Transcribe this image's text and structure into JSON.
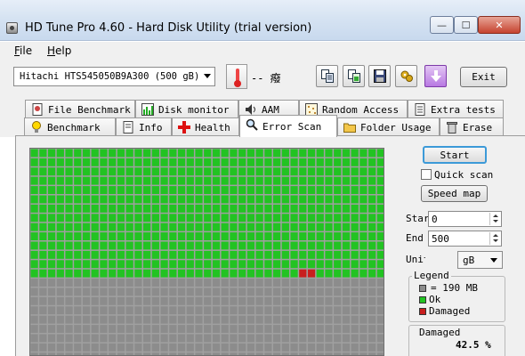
{
  "window": {
    "title": "HD Tune Pro 4.60 - Hard Disk Utility (trial version)",
    "controls": {
      "minimize": "—",
      "maximize": "☐",
      "close": "✕"
    }
  },
  "menu": {
    "items": [
      "File",
      "Help"
    ]
  },
  "toolbar": {
    "drive": "Hitachi HTS545050B9A300  (500 gB)",
    "temperature": "-- 癈",
    "buttons": [
      "copy-info-icon",
      "copy-screenshot-icon",
      "save-icon",
      "options-icon",
      "download-icon"
    ],
    "exit_label": "Exit"
  },
  "tabs": {
    "row1": [
      "File Benchmark",
      "Disk monitor",
      "AAM",
      "Random Access",
      "Extra tests"
    ],
    "row2": [
      "Benchmark",
      "Info",
      "Health",
      "Error Scan",
      "Folder Usage",
      "Erase"
    ],
    "active": "Error Scan"
  },
  "error_scan": {
    "start_label": "Start",
    "quick_scan_label": "Quick scan",
    "quick_scan_checked": false,
    "speed_map_label": "Speed map",
    "start_field_label": "Star",
    "start_value": "0",
    "end_field_label": "End",
    "end_value": "500",
    "unit_label": "Unit",
    "unit_value": "gB",
    "legend_title": "Legend",
    "legend": [
      {
        "label": "= 190 MB",
        "color": "#8c8c8c"
      },
      {
        "label": "Ok",
        "color": "#22c322"
      },
      {
        "label": "Damaged",
        "color": "#c81e1e"
      }
    ],
    "damaged_title": "Damaged",
    "damaged_value": "42.5 %",
    "grid": {
      "columns": 41,
      "scanned_rows": 14,
      "damaged_block": {
        "row": 13,
        "col": 31,
        "span": 2
      },
      "colors": {
        "ok": "#22c322",
        "pending": "#8c8c8c",
        "damaged": "#c81e1e"
      }
    }
  }
}
